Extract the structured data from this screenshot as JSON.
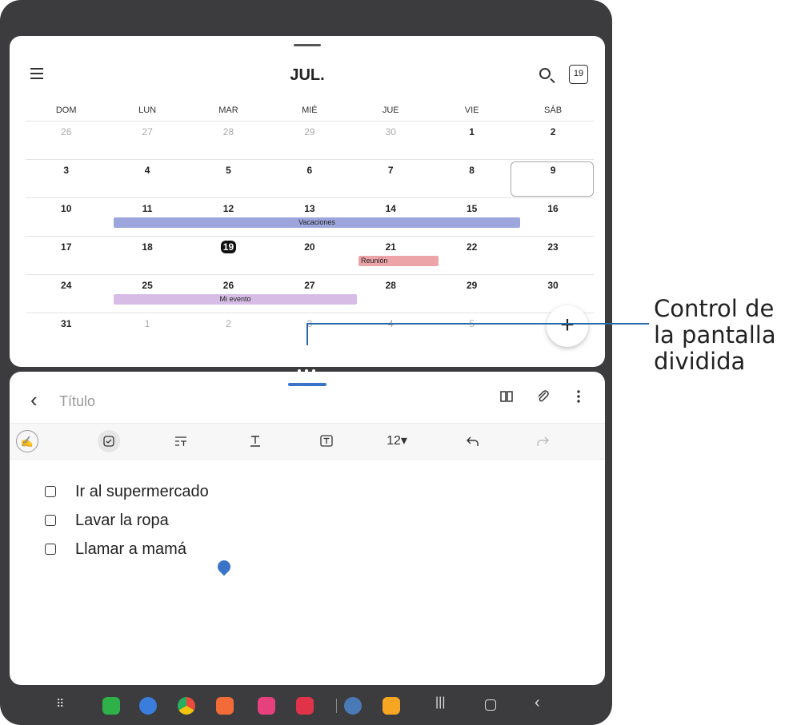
{
  "calendar": {
    "month_title": "JUL.",
    "today_icon_label": "19",
    "day_names": [
      "DOM",
      "LUN",
      "MAR",
      "MIÉ",
      "JUE",
      "VIE",
      "SÁB"
    ],
    "weeks": [
      [
        "26",
        "27",
        "28",
        "29",
        "30",
        "1",
        "2"
      ],
      [
        "3",
        "4",
        "5",
        "6",
        "7",
        "8",
        "9"
      ],
      [
        "10",
        "11",
        "12",
        "13",
        "14",
        "15",
        "16"
      ],
      [
        "17",
        "18",
        "19",
        "20",
        "21",
        "22",
        "23"
      ],
      [
        "24",
        "25",
        "26",
        "27",
        "28",
        "29",
        "30"
      ],
      [
        "31",
        "1",
        "2",
        "3",
        "4",
        "5",
        ""
      ]
    ],
    "events": {
      "vacaciones": "Vacaciones",
      "reunion": "Reunión",
      "mi_evento": "Mi evento"
    },
    "fab_label": "+"
  },
  "notes": {
    "title_placeholder": "Título",
    "toolbar": {
      "font_size": "12▾"
    },
    "checklist": [
      "Ir al supermercado",
      "Lavar la ropa",
      "Llamar a mamá"
    ]
  },
  "annotation": {
    "line1": "Control de",
    "line2": "la pantalla",
    "line3": "dividida"
  }
}
